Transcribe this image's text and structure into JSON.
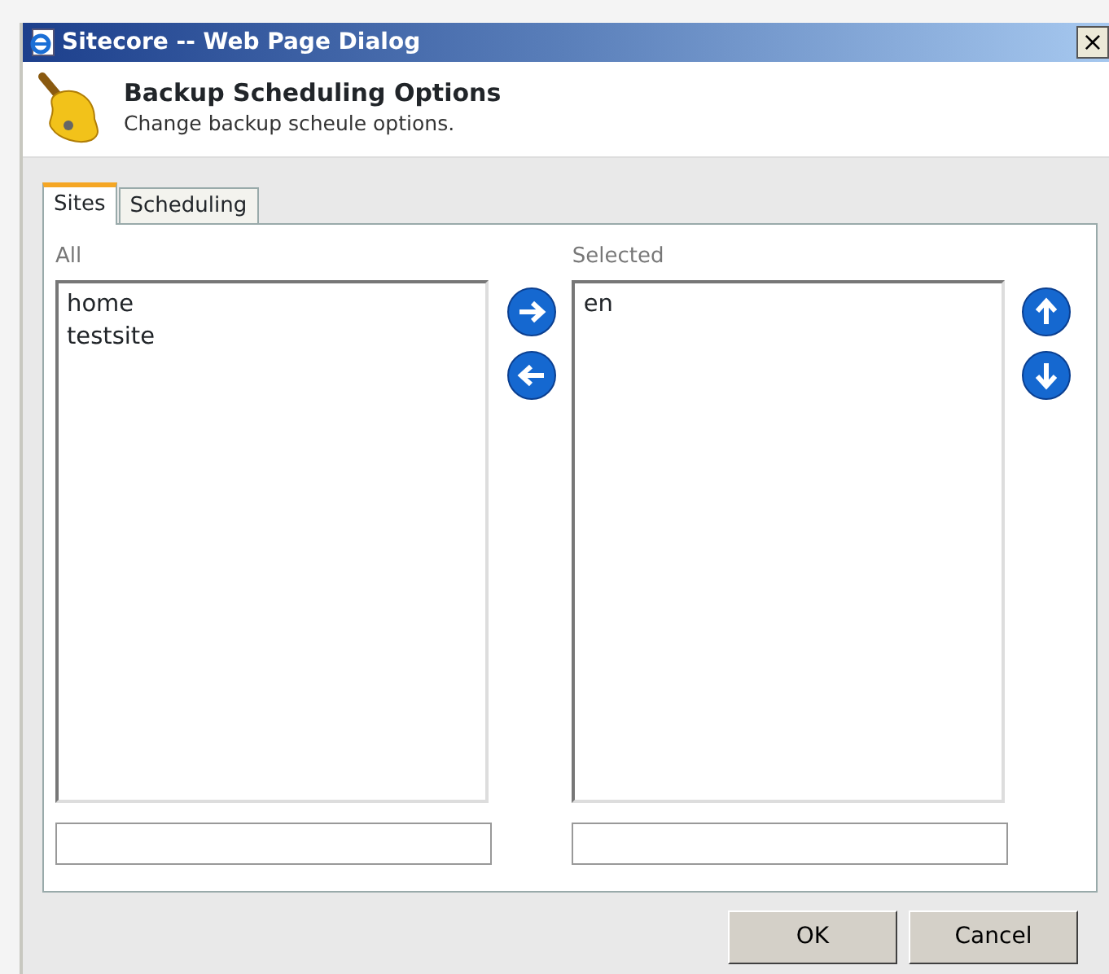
{
  "window": {
    "title": "Sitecore -- Web Page Dialog",
    "close": "×"
  },
  "header": {
    "title": "Backup Scheduling Options",
    "subtitle": "Change backup scheule options."
  },
  "tabs": [
    {
      "label": "Sites",
      "selected": true
    },
    {
      "label": "Scheduling",
      "selected": false
    }
  ],
  "all_list": {
    "label": "All",
    "items": [
      "home",
      "testsite"
    ]
  },
  "selected_list": {
    "label": "Selected",
    "items": [
      "en"
    ]
  },
  "buttons": [
    "OK",
    "Cancel"
  ]
}
